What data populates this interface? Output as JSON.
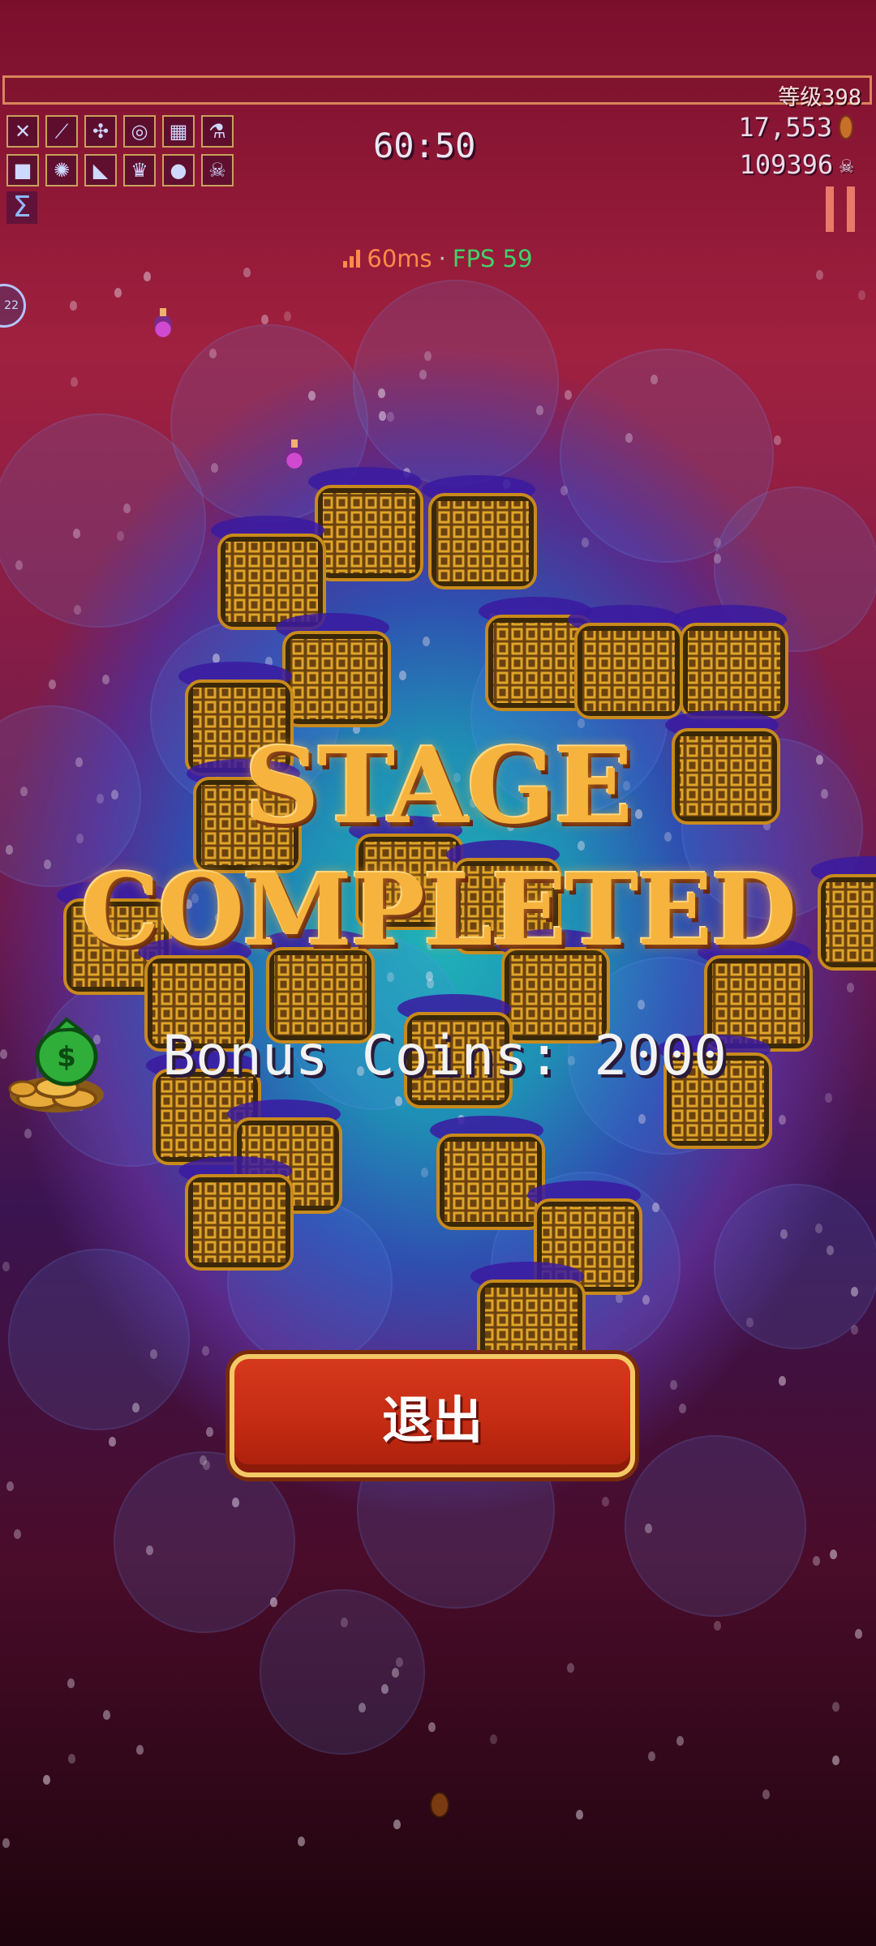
{
  "hud": {
    "level_label": "等级398",
    "xp_fraction": 0.0,
    "timer": "60:50",
    "coins": "17,553",
    "kills": "109396",
    "weapon_slots": [
      {
        "name": "crossed-lines-icon",
        "glyph": "✕"
      },
      {
        "name": "wand-icon",
        "glyph": "⟋"
      },
      {
        "name": "plant-icon",
        "glyph": "✣"
      },
      {
        "name": "target-icon",
        "glyph": "◎"
      },
      {
        "name": "grid-icon",
        "glyph": "▦"
      },
      {
        "name": "flask-icon",
        "glyph": "⚗"
      }
    ],
    "item_slots": [
      {
        "name": "red-box-icon",
        "glyph": "■"
      },
      {
        "name": "spider-icon",
        "glyph": "✺"
      },
      {
        "name": "scroll-icon",
        "glyph": "◣"
      },
      {
        "name": "crown-icon",
        "glyph": "♛"
      },
      {
        "name": "orb-icon",
        "glyph": "●"
      },
      {
        "name": "skull-icon",
        "glyph": "☠"
      }
    ],
    "colors": {
      "slot_border": "#c8a05c",
      "xp_border": "#d8855a",
      "pause": "#e87a6a"
    }
  },
  "network": {
    "ping": "60ms",
    "separator": "·",
    "fps": "FPS 59",
    "ping_color": "#ff8a4a",
    "fps_color": "#3fd36a"
  },
  "result": {
    "title_line1": "STAGE",
    "title_line2": "COMPLETED",
    "bonus_text": "Bonus Coins: 2000",
    "exit_label": "退出",
    "title_color": "#f6b43e",
    "button_color": "#c22a12"
  }
}
